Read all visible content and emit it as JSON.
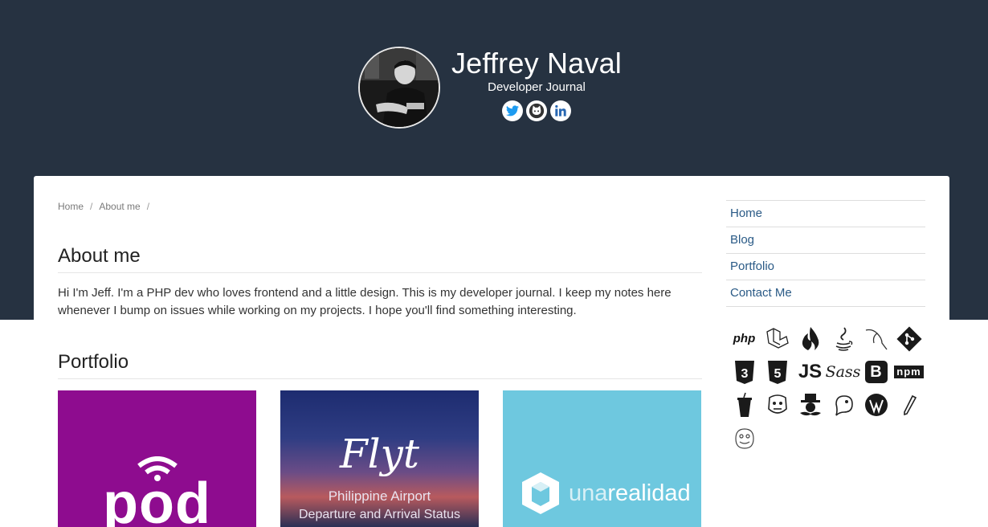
{
  "header": {
    "name": "Jeffrey Naval",
    "subtitle": "Developer Journal",
    "socials": [
      "twitter-icon",
      "github-icon",
      "linkedin-icon"
    ],
    "background": "#263241"
  },
  "breadcrumb": [
    "Home",
    "About me"
  ],
  "breadcrumb_separator": "/",
  "about": {
    "title": "About me",
    "text": "Hi I'm Jeff. I'm a PHP dev who loves frontend and a little design. This is my developer journal. I keep my notes here whenever I bump on issues while working on my projects. I hope you'll find something interesting."
  },
  "portfolio": {
    "title": "Portfolio",
    "items": [
      {
        "logo": "pod",
        "color": "#8e0c8f"
      },
      {
        "logo": "Flyt",
        "caption": "Philippine Airport",
        "caption2": "Departure and Arrival Status",
        "color": "#2f3d83"
      },
      {
        "logo_left": "una",
        "logo_right": "realidad",
        "color": "#6ec8df"
      }
    ]
  },
  "sidebar": {
    "links": [
      "Home",
      "Blog",
      "Portfolio",
      "Contact Me"
    ],
    "link_color": "#2a5a86"
  },
  "skills": {
    "icons": [
      "php-icon",
      "laravel-icon",
      "codeigniter-icon",
      "java-icon",
      "mysql-icon",
      "git-icon",
      "css3-icon",
      "html5-icon",
      "javascript-icon",
      "sass-icon",
      "bootstrap-icon",
      "npm-icon",
      "gulp-icon",
      "grunt-icon",
      "composer-icon",
      "phpunit-icon",
      "wordpress-icon",
      "pencil-icon",
      "bower-icon"
    ],
    "php_label": "php",
    "js_label": "JS",
    "sass_label": "Sass",
    "bootstrap_label": "B",
    "npm_label": "npm",
    "css_label": "3",
    "html_label": "5"
  }
}
